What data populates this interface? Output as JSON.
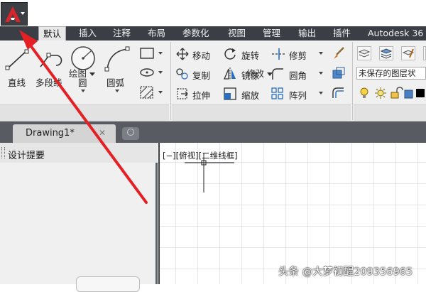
{
  "tabs": [
    "默认",
    "插入",
    "注释",
    "布局",
    "参数化",
    "视图",
    "管理",
    "输出",
    "插件",
    "Autodesk 36"
  ],
  "draw_panel": {
    "line": "直线",
    "polyline": "多段线",
    "circle": "圆",
    "arc": "圆弧",
    "title": "绘图"
  },
  "modify_panel": {
    "move": "移动",
    "rotate": "旋转",
    "trim": "修剪",
    "copy": "复制",
    "mirror": "镜像",
    "fillet": "圆角",
    "stretch": "拉伸",
    "scale": "缩放",
    "array": "阵列",
    "title": "修改"
  },
  "layers_panel": {
    "layer_state": "未保存的图层状"
  },
  "document_tab": {
    "label": "Drawing1*",
    "close": "✕"
  },
  "palette": {
    "title": "设计提要"
  },
  "viewport": {
    "label": "[−][俯视][二维线框]"
  },
  "watermark": "头条 @大梦初醒209356965",
  "colors": {
    "arrow": "#e52025",
    "ribbon_tabs_bg": "#3b3f45",
    "app_logo": "#d8262c"
  }
}
